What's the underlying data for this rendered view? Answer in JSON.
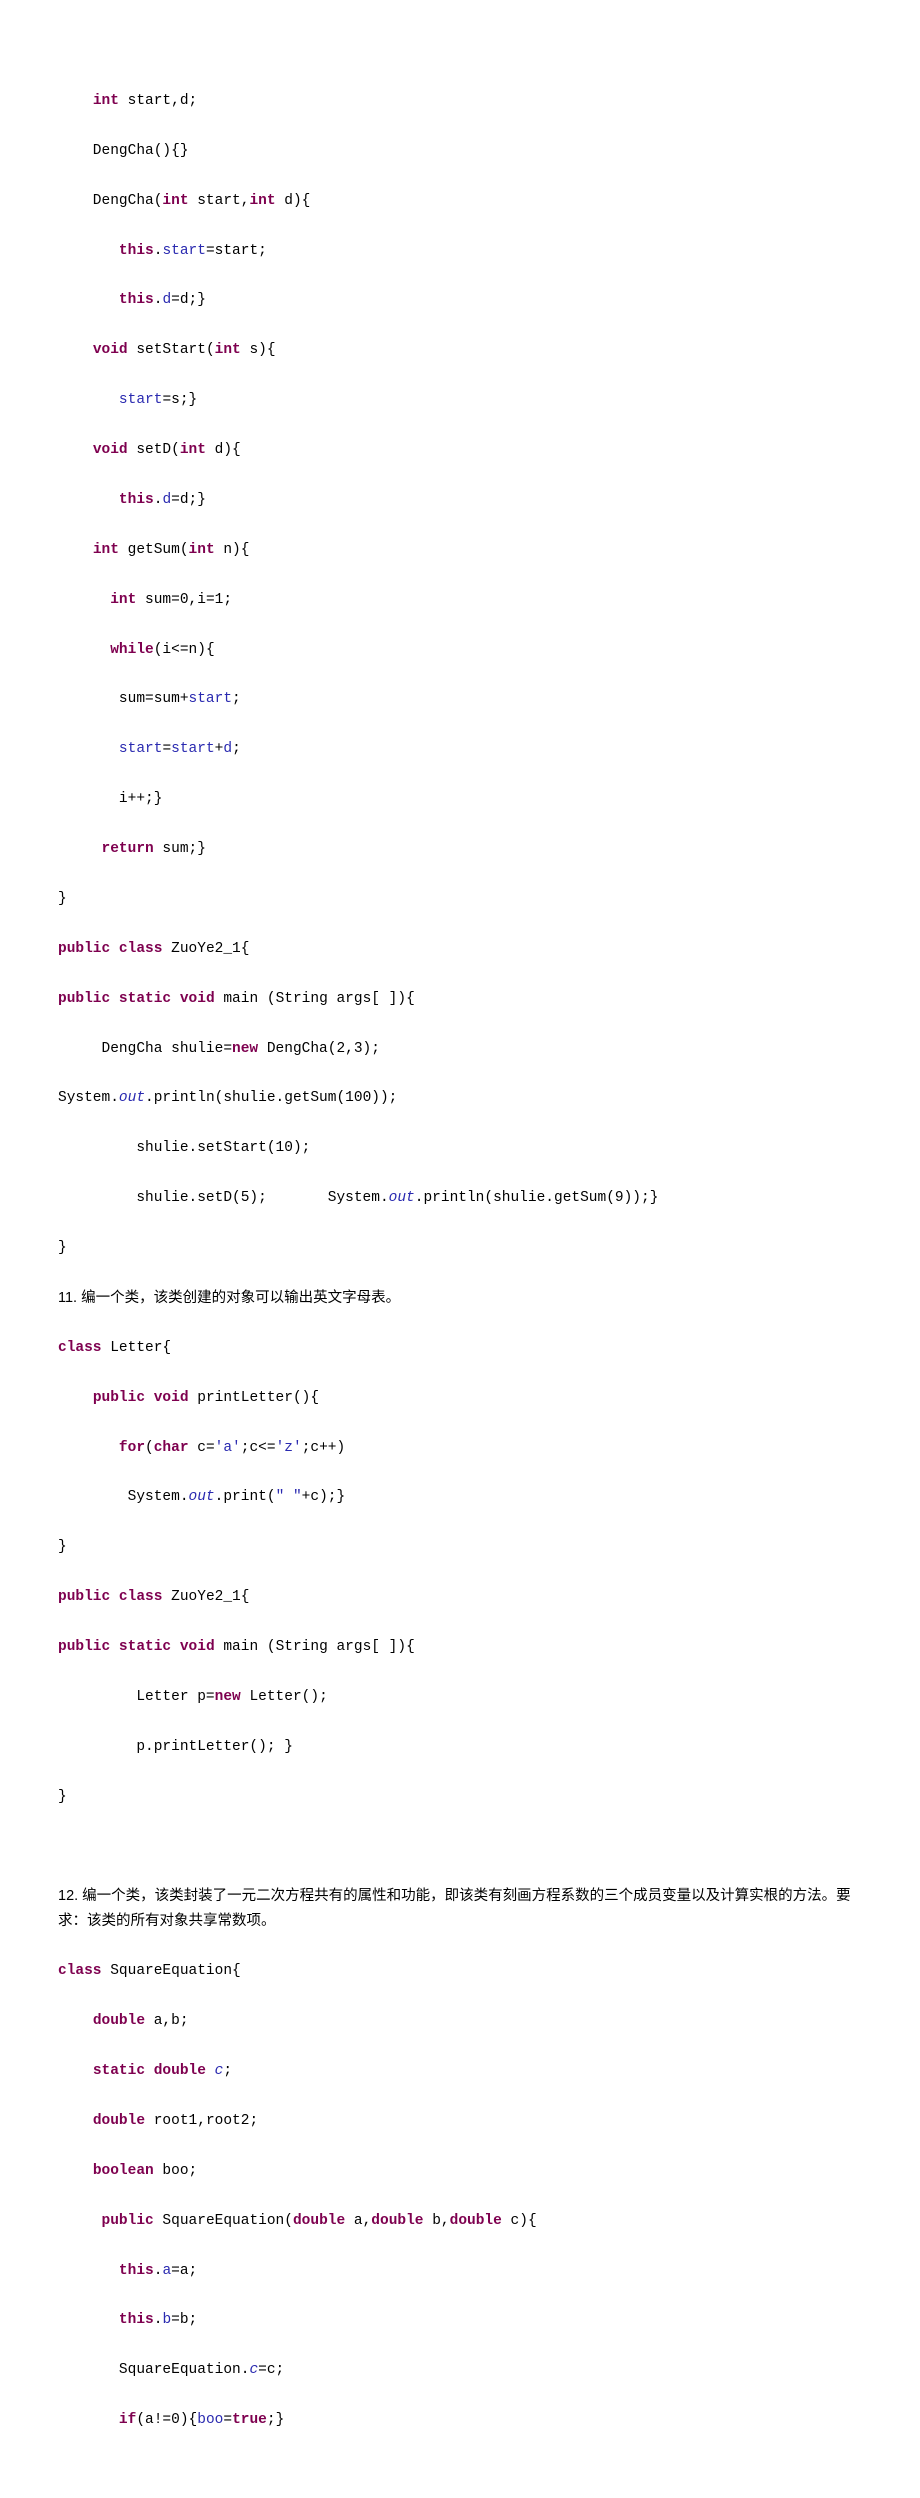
{
  "code1": {
    "l01a": "int",
    "l01b": " start,d;",
    "l02": "    DengCha(){}",
    "l03a": "    DengCha(",
    "l03b": "int",
    "l03c": " start,",
    "l03d": "int",
    "l03e": " d){",
    "l04a": "       ",
    "l04b": "this",
    "l04c": ".",
    "l04d": "start",
    "l04e": "=start;",
    "l05a": "       ",
    "l05b": "this",
    "l05c": ".",
    "l05d": "d",
    "l05e": "=d;}",
    "l06a": "    ",
    "l06b": "void",
    "l06c": " setStart(",
    "l06d": "int",
    "l06e": " s){",
    "l07a": "       ",
    "l07b": "start",
    "l07c": "=s;}",
    "l08a": "    ",
    "l08b": "void",
    "l08c": " setD(",
    "l08d": "int",
    "l08e": " d){",
    "l09a": "       ",
    "l09b": "this",
    "l09c": ".",
    "l09d": "d",
    "l09e": "=d;}",
    "l10a": "    ",
    "l10b": "int",
    "l10c": " getSum(",
    "l10d": "int",
    "l10e": " n){",
    "l11a": "      ",
    "l11b": "int",
    "l11c": " sum=0,i=1;",
    "l12a": "      ",
    "l12b": "while",
    "l12c": "(i<=n){",
    "l13a": "       sum=sum+",
    "l13b": "start",
    "l13c": ";",
    "l14a": "       ",
    "l14b": "start",
    "l14c": "=",
    "l14d": "start",
    "l14e": "+",
    "l14f": "d",
    "l14g": ";",
    "l15": "       i++;}",
    "l16a": "     ",
    "l16b": "return",
    "l16c": " sum;}",
    "l17": "}",
    "l18a": "public",
    "l18b": "class",
    "l18c": " ZuoYe2_1{",
    "l19a": "public",
    "l19b": "static",
    "l19c": "void",
    "l19d": " main (String args[ ]){",
    "l20a": "     DengCha shulie=",
    "l20b": "new",
    "l20c": " DengCha(2,3);",
    "l21a": "System.",
    "l21b": "out",
    "l21c": ".println(shulie.getSum(100));",
    "l22": "         shulie.setStart(10);",
    "l23a": "         shulie.setD(5);       System.",
    "l23b": "out",
    "l23c": ".println(shulie.getSum(9));}",
    "l24": "}"
  },
  "q11": "11. 编一个类，该类创建的对象可以输出英文字母表。",
  "code2": {
    "l01a": "class",
    "l01b": " Letter{",
    "l02a": "    ",
    "l02b": "public",
    "l02c": "void",
    "l02d": " printLetter(){",
    "l03a": "       ",
    "l03b": "for",
    "l03c": "(",
    "l03d": "char",
    "l03e": " c=",
    "l03f": "'a'",
    "l03g": ";c<=",
    "l03h": "'z'",
    "l03i": ";c++)",
    "l04a": "        System.",
    "l04b": "out",
    "l04c": ".print(",
    "l04d": "\" \"",
    "l04e": "+c);}",
    "l05": "}",
    "l06a": "public",
    "l06b": "class",
    "l06c": " ZuoYe2_1{",
    "l07a": "public",
    "l07b": "static",
    "l07c": "void",
    "l07d": " main (String args[ ]){",
    "l08a": "         Letter p=",
    "l08b": "new",
    "l08c": " Letter();",
    "l09": "         p.printLetter(); }",
    "l10": "}"
  },
  "q12": "12. 编一个类，该类封装了一元二次方程共有的属性和功能，即该类有刻画方程系数的三个成员变量以及计算实根的方法。要求：该类的所有对象共享常数项。",
  "code3": {
    "l01a": "class",
    "l01b": " SquareEquation{",
    "l02a": "    ",
    "l02b": "double",
    "l02c": " a,b;",
    "l03a": "    ",
    "l03b": "static",
    "l03c": "double",
    "l03d": "c",
    "l03e": ";",
    "l04a": "    ",
    "l04b": "double",
    "l04c": " root1,root2;",
    "l05a": "    ",
    "l05b": "boolean",
    "l05c": " boo;",
    "l06a": "     ",
    "l06b": "public",
    "l06c": " SquareEquation(",
    "l06d": "double",
    "l06e": " a,",
    "l06f": "double",
    "l06g": " b,",
    "l06h": "double",
    "l06i": " c){",
    "l07a": "       ",
    "l07b": "this",
    "l07c": ".",
    "l07d": "a",
    "l07e": "=a;",
    "l08a": "       ",
    "l08b": "this",
    "l08c": ".",
    "l08d": "b",
    "l08e": "=b;",
    "l09a": "       SquareEquation.",
    "l09b": "c",
    "l09c": "=c;",
    "l10a": "       ",
    "l10b": "if",
    "l10c": "(a!=0){",
    "l10d": "boo",
    "l10e": "=",
    "l10f": "true",
    "l10g": ";}"
  }
}
